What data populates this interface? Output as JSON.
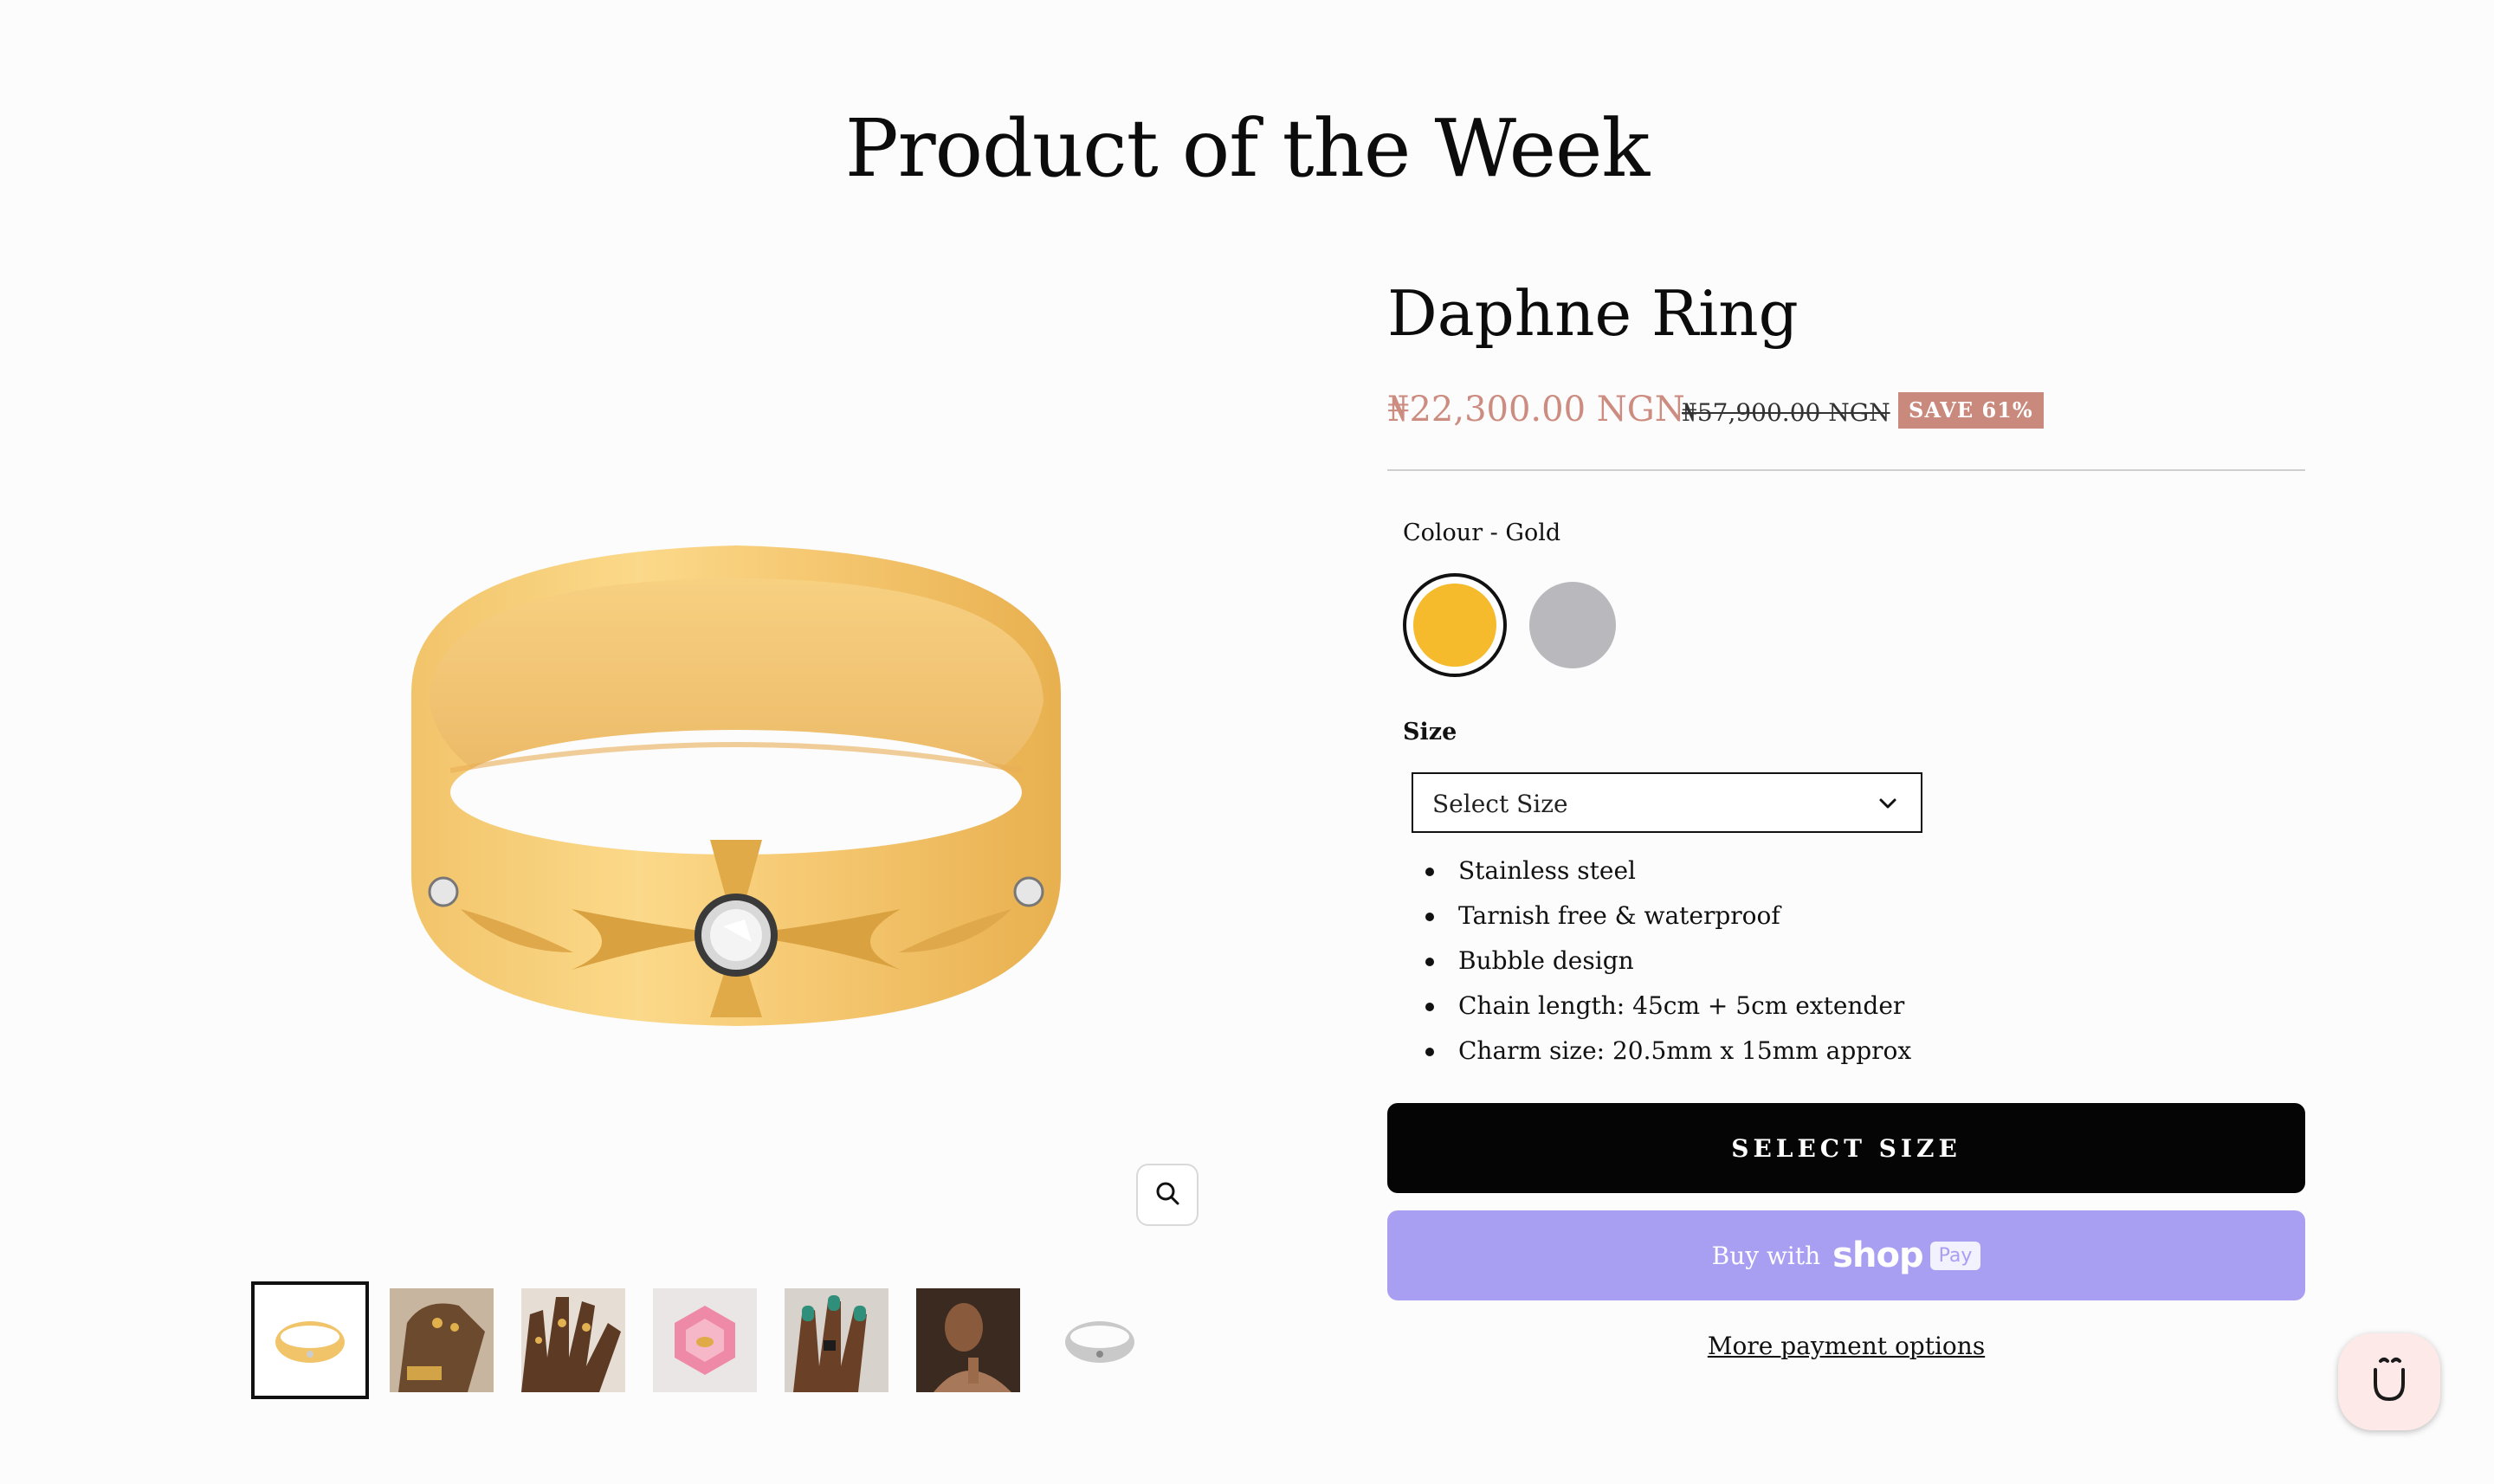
{
  "section": {
    "title": "Product of the Week"
  },
  "product": {
    "title": "Daphne Ring",
    "price_sale": "₦22,300.00 NGN",
    "price_regular": "₦57,900.00 NGN",
    "save_badge": "SAVE 61%",
    "colour_label": "Colour - Gold",
    "colours": [
      {
        "name": "Gold",
        "hex": "#f5bb2c",
        "selected": true
      },
      {
        "name": "Silver",
        "hex": "#b9b8bc",
        "selected": false
      }
    ],
    "size_label": "Size",
    "size_select_value": "Select Size",
    "features": [
      "Stainless steel",
      "Tarnish free & waterproof",
      "Bubble design",
      "Chain length: 45cm + 5cm extender",
      "Charm size: 20.5mm x 15mm approx"
    ],
    "select_size_button": "SELECT SIZE",
    "shop_pay": {
      "buy_with": "Buy with",
      "shop": "shop",
      "pay": "Pay"
    },
    "more_payment_options": "More payment options"
  },
  "gallery": {
    "thumbnails": [
      {
        "name": "gold ring",
        "active": true
      },
      {
        "name": "hand with rings",
        "active": false
      },
      {
        "name": "fingers with rings",
        "active": false
      },
      {
        "name": "pink ring box",
        "active": false
      },
      {
        "name": "hand with green nails",
        "active": false
      },
      {
        "name": "woman portrait",
        "active": false
      },
      {
        "name": "silver ring",
        "active": false
      }
    ]
  },
  "colors": {
    "accent": "#cc8c80",
    "badge": "#c98a7d",
    "shop_pay": "#a89ff3",
    "button": "#050505"
  },
  "icons": {
    "zoom": "magnifier-icon",
    "chevron": "chevron-down-icon",
    "chat": "smiley-chat-icon"
  }
}
